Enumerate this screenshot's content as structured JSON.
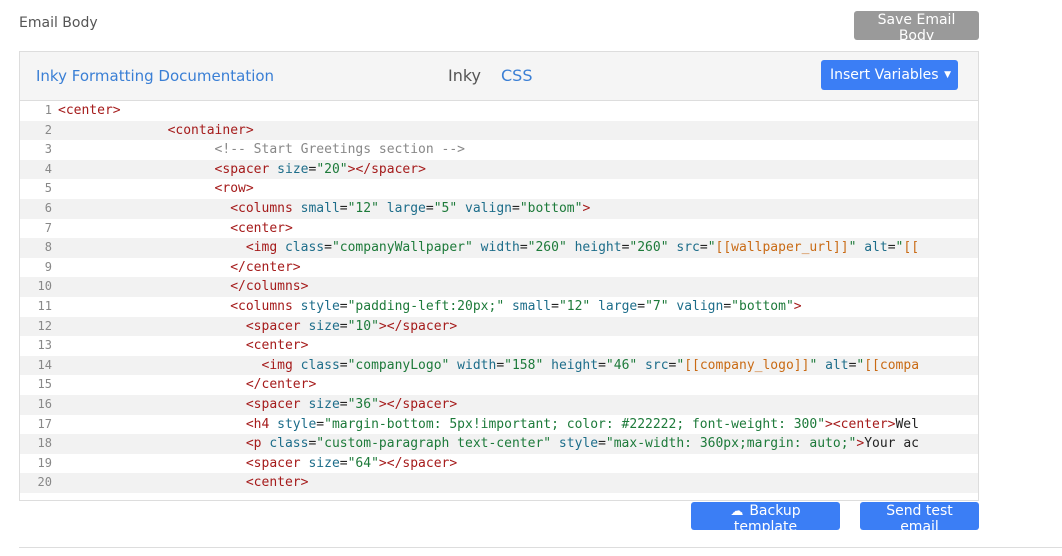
{
  "header": {
    "title": "Email Body",
    "save_label": "Save Email Body"
  },
  "editor": {
    "doc_link": "Inky Formatting Documentation",
    "tabs": [
      "Inky",
      "CSS"
    ],
    "insert_label": "Insert Variables",
    "lines": [
      {
        "num": "1",
        "indent": "",
        "parts": [
          [
            "tag",
            "<center>"
          ]
        ]
      },
      {
        "num": "2",
        "indent": "              ",
        "parts": [
          [
            "tag",
            "<container>"
          ]
        ]
      },
      {
        "num": "3",
        "indent": "                    ",
        "parts": [
          [
            "com",
            "<!-- Start Greetings section -->"
          ]
        ]
      },
      {
        "num": "4",
        "indent": "                    ",
        "parts": [
          [
            "tag",
            "<spacer "
          ],
          [
            "attr",
            "size"
          ],
          [
            "txt",
            "="
          ],
          [
            "str",
            "\"20\""
          ],
          [
            "tag",
            "></spacer>"
          ]
        ]
      },
      {
        "num": "5",
        "indent": "                    ",
        "parts": [
          [
            "tag",
            "<row>"
          ]
        ]
      },
      {
        "num": "6",
        "indent": "                      ",
        "parts": [
          [
            "tag",
            "<columns "
          ],
          [
            "attr",
            "small"
          ],
          [
            "txt",
            "="
          ],
          [
            "str",
            "\"12\""
          ],
          [
            "attr",
            " large"
          ],
          [
            "txt",
            "="
          ],
          [
            "str",
            "\"5\""
          ],
          [
            "attr",
            " valign"
          ],
          [
            "txt",
            "="
          ],
          [
            "str",
            "\"bottom\""
          ],
          [
            "tag",
            ">"
          ]
        ]
      },
      {
        "num": "7",
        "indent": "                      ",
        "parts": [
          [
            "tag",
            "<center>"
          ]
        ]
      },
      {
        "num": "8",
        "indent": "                        ",
        "parts": [
          [
            "tag",
            "<img "
          ],
          [
            "attr",
            "class"
          ],
          [
            "txt",
            "="
          ],
          [
            "str",
            "\"companyWallpaper\""
          ],
          [
            "attr",
            " width"
          ],
          [
            "txt",
            "="
          ],
          [
            "str",
            "\"260\""
          ],
          [
            "attr",
            " height"
          ],
          [
            "txt",
            "="
          ],
          [
            "str",
            "\"260\""
          ],
          [
            "attr",
            " src"
          ],
          [
            "txt",
            "="
          ],
          [
            "str",
            "\""
          ],
          [
            "tpl",
            "[[wallpaper_url]]"
          ],
          [
            "str",
            "\""
          ],
          [
            "attr",
            " alt"
          ],
          [
            "txt",
            "="
          ],
          [
            "str",
            "\""
          ],
          [
            "tpl",
            "[["
          ]
        ]
      },
      {
        "num": "9",
        "indent": "                      ",
        "parts": [
          [
            "tag",
            "</center>"
          ]
        ]
      },
      {
        "num": "10",
        "indent": "                      ",
        "parts": [
          [
            "tag",
            "</columns>"
          ]
        ]
      },
      {
        "num": "11",
        "indent": "                      ",
        "parts": [
          [
            "tag",
            "<columns "
          ],
          [
            "attr",
            "style"
          ],
          [
            "txt",
            "="
          ],
          [
            "str",
            "\"padding-left:20px;\""
          ],
          [
            "attr",
            " small"
          ],
          [
            "txt",
            "="
          ],
          [
            "str",
            "\"12\""
          ],
          [
            "attr",
            " large"
          ],
          [
            "txt",
            "="
          ],
          [
            "str",
            "\"7\""
          ],
          [
            "attr",
            " valign"
          ],
          [
            "txt",
            "="
          ],
          [
            "str",
            "\"bottom\""
          ],
          [
            "tag",
            ">"
          ]
        ]
      },
      {
        "num": "12",
        "indent": "                        ",
        "parts": [
          [
            "tag",
            "<spacer "
          ],
          [
            "attr",
            "size"
          ],
          [
            "txt",
            "="
          ],
          [
            "str",
            "\"10\""
          ],
          [
            "tag",
            "></spacer>"
          ]
        ]
      },
      {
        "num": "13",
        "indent": "                        ",
        "parts": [
          [
            "tag",
            "<center>"
          ]
        ]
      },
      {
        "num": "14",
        "indent": "                          ",
        "parts": [
          [
            "tag",
            "<img "
          ],
          [
            "attr",
            "class"
          ],
          [
            "txt",
            "="
          ],
          [
            "str",
            "\"companyLogo\""
          ],
          [
            "attr",
            " width"
          ],
          [
            "txt",
            "="
          ],
          [
            "str",
            "\"158\""
          ],
          [
            "attr",
            " height"
          ],
          [
            "txt",
            "="
          ],
          [
            "str",
            "\"46\""
          ],
          [
            "attr",
            " src"
          ],
          [
            "txt",
            "="
          ],
          [
            "str",
            "\""
          ],
          [
            "tpl",
            "[[company_logo]]"
          ],
          [
            "str",
            "\""
          ],
          [
            "attr",
            " alt"
          ],
          [
            "txt",
            "="
          ],
          [
            "str",
            "\""
          ],
          [
            "tpl",
            "[[compa"
          ]
        ]
      },
      {
        "num": "15",
        "indent": "                        ",
        "parts": [
          [
            "tag",
            "</center>"
          ]
        ]
      },
      {
        "num": "16",
        "indent": "                        ",
        "parts": [
          [
            "tag",
            "<spacer "
          ],
          [
            "attr",
            "size"
          ],
          [
            "txt",
            "="
          ],
          [
            "str",
            "\"36\""
          ],
          [
            "tag",
            "></spacer>"
          ]
        ]
      },
      {
        "num": "17",
        "indent": "                        ",
        "parts": [
          [
            "tag",
            "<h4 "
          ],
          [
            "attr",
            "style"
          ],
          [
            "txt",
            "="
          ],
          [
            "str",
            "\"margin-bottom: 5px!important; color: #222222; font-weight: 300\""
          ],
          [
            "tag",
            "><center>"
          ],
          [
            "txt",
            "Wel"
          ]
        ]
      },
      {
        "num": "18",
        "indent": "                        ",
        "parts": [
          [
            "tag",
            "<p "
          ],
          [
            "attr",
            "class"
          ],
          [
            "txt",
            "="
          ],
          [
            "str",
            "\"custom-paragraph text-center\""
          ],
          [
            "attr",
            " style"
          ],
          [
            "txt",
            "="
          ],
          [
            "str",
            "\"max-width: 360px;margin: auto;\""
          ],
          [
            "tag",
            ">"
          ],
          [
            "txt",
            "Your ac"
          ]
        ]
      },
      {
        "num": "19",
        "indent": "                        ",
        "parts": [
          [
            "tag",
            "<spacer "
          ],
          [
            "attr",
            "size"
          ],
          [
            "txt",
            "="
          ],
          [
            "str",
            "\"64\""
          ],
          [
            "tag",
            "></spacer>"
          ]
        ]
      },
      {
        "num": "20",
        "indent": "                        ",
        "parts": [
          [
            "tag",
            "<center>"
          ]
        ]
      }
    ]
  },
  "footer": {
    "backup_label": "Backup template",
    "send_label": "Send test email"
  },
  "icons": {
    "backup": "cloud-upload-icon",
    "insert_caret": "caret-down-icon"
  }
}
